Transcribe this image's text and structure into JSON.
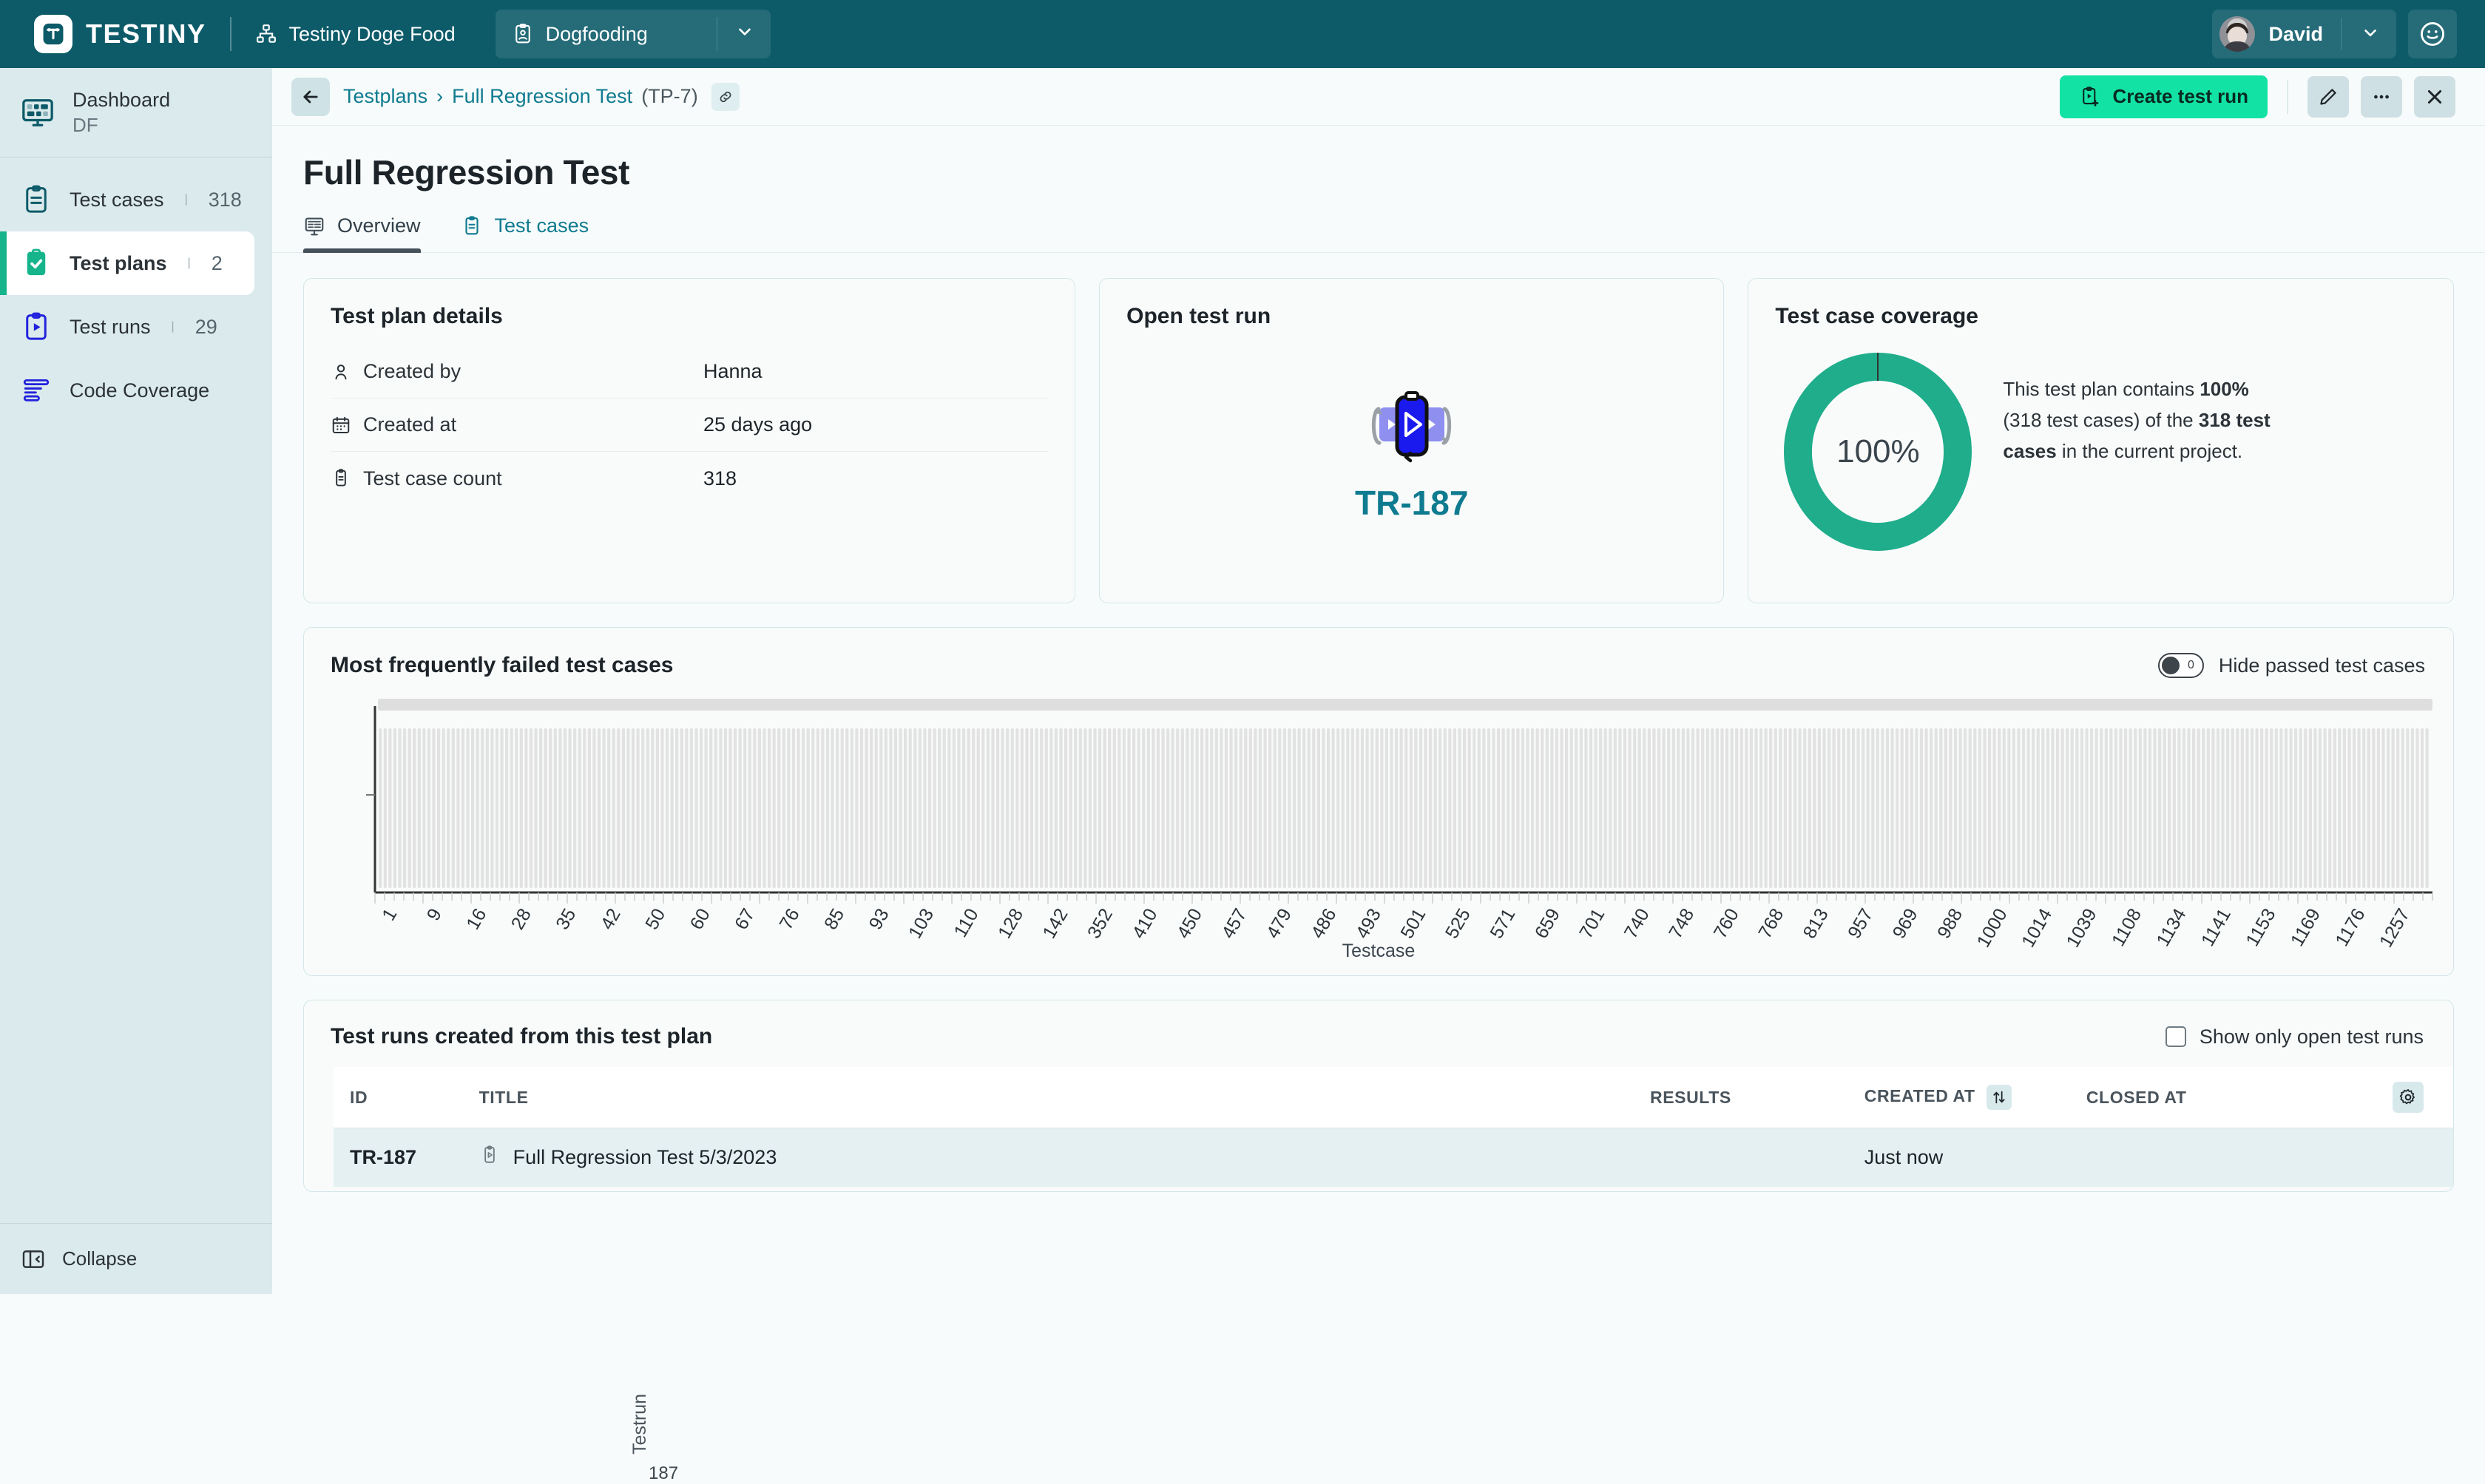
{
  "topbar": {
    "brand": "TESTINY",
    "workspace": "Testiny Doge Food",
    "project": "Dogfooding",
    "user": "David"
  },
  "sidebar": {
    "dashboard": {
      "title": "Dashboard",
      "subtitle": "DF"
    },
    "items": [
      {
        "label": "Test cases",
        "count": "318"
      },
      {
        "label": "Test plans",
        "count": "2"
      },
      {
        "label": "Test runs",
        "count": "29"
      },
      {
        "label": "Code Coverage",
        "count": ""
      }
    ],
    "divider": "|",
    "collapse": "Collapse"
  },
  "breadcrumb": {
    "root": "Testplans",
    "separator": "›",
    "current": "Full Regression Test",
    "id": "(TP-7)"
  },
  "actions": {
    "create_test_run": "Create test run"
  },
  "page": {
    "title": "Full Regression Test"
  },
  "tabs": [
    {
      "label": "Overview",
      "active": true
    },
    {
      "label": "Test cases",
      "active": false
    }
  ],
  "test_plan_details": {
    "title": "Test plan details",
    "rows": [
      {
        "label": "Created by",
        "value": "Hanna"
      },
      {
        "label": "Created at",
        "value": "25 days ago"
      },
      {
        "label": "Test case count",
        "value": "318"
      }
    ]
  },
  "open_test_run": {
    "title": "Open test run",
    "run_id": "TR-187"
  },
  "coverage": {
    "title": "Test case coverage",
    "percent_label": "100%",
    "text_1": "This test plan contains ",
    "text_b1": "100%",
    "text_2": "\n(318 test cases)",
    "text_3": " of the ",
    "text_b2": "318 test cases",
    "text_4": " in the current project.",
    "accent_color": "#1fad8b"
  },
  "failed_chart": {
    "title": "Most frequently failed test cases",
    "toggle_label": "Hide passed test cases",
    "toggle_state": "0",
    "toggle_on": false
  },
  "chart_data": {
    "type": "bar",
    "title": "Most frequently failed test cases",
    "xlabel": "Testcase",
    "ylabel": "Testrun",
    "grid": false,
    "legend": null,
    "y_ticks": [
      "187"
    ],
    "categories": [
      "1",
      "9",
      "16",
      "28",
      "35",
      "42",
      "50",
      "60",
      "67",
      "76",
      "85",
      "93",
      "103",
      "110",
      "128",
      "142",
      "352",
      "410",
      "450",
      "457",
      "479",
      "486",
      "493",
      "501",
      "525",
      "571",
      "659",
      "701",
      "740",
      "748",
      "760",
      "768",
      "813",
      "957",
      "969",
      "988",
      "1000",
      "1014",
      "1039",
      "1108",
      "1134",
      "1141",
      "1153",
      "1169",
      "1176",
      "1257"
    ],
    "series": [
      {
        "name": "Testrun 187",
        "values": [
          1,
          1,
          1,
          1,
          1,
          1,
          1,
          1,
          1,
          1,
          1,
          1,
          1,
          1,
          1,
          1,
          1,
          1,
          1,
          1,
          1,
          1,
          1,
          1,
          1,
          1,
          1,
          1,
          1,
          1,
          1,
          1,
          1,
          1,
          1,
          1,
          1,
          1,
          1,
          1,
          1,
          1,
          1,
          1,
          1,
          1
        ]
      }
    ],
    "note": "bars rendered as light-gray placeholder columns (unloaded results)"
  },
  "runs_table": {
    "title": "Test runs created from this test plan",
    "filter_label": "Show only open test runs",
    "filter_checked": false,
    "columns": [
      "ID",
      "TITLE",
      "RESULTS",
      "CREATED AT",
      "CLOSED AT"
    ],
    "sorted_column": "CREATED AT",
    "rows": [
      {
        "id": "TR-187",
        "title": "Full Regression Test 5/3/2023",
        "results": "",
        "created_at": "Just now",
        "closed_at": ""
      }
    ]
  }
}
